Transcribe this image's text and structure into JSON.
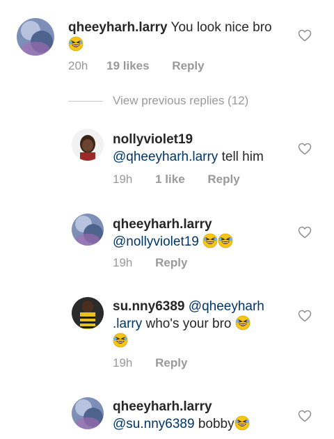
{
  "comment": {
    "username": "qheeyharh.larry",
    "text": "You look nice bro",
    "time": "20h",
    "likes": "19 likes",
    "reply": "Reply"
  },
  "view_previous": "View previous replies (12)",
  "replies": [
    {
      "username": "nollyviolet19",
      "mention": "@qheeyharh.larry",
      "text": "tell him",
      "time": "19h",
      "likes": "1 like",
      "reply": "Reply"
    },
    {
      "username": "qheeyharh.larry",
      "mention": "@nollyviolet19",
      "text": "",
      "time": "19h",
      "reply": "Reply"
    },
    {
      "username": "su.nny6389",
      "mention_part1": "@qheeyharh",
      "mention_part2": ".larry",
      "text": "who's your bro",
      "time": "19h",
      "reply": "Reply"
    },
    {
      "username": "qheeyharh.larry",
      "mention": "@su.nny6389",
      "text": "bobby",
      "time": "",
      "reply": ""
    }
  ],
  "icons": {
    "like": "heart-outline-icon",
    "emoji": "rolling-on-floor-laughing-emoji"
  },
  "colors": {
    "text": "#262626",
    "meta": "#999999",
    "mention": "#003569",
    "emoji": "#f5c518"
  }
}
